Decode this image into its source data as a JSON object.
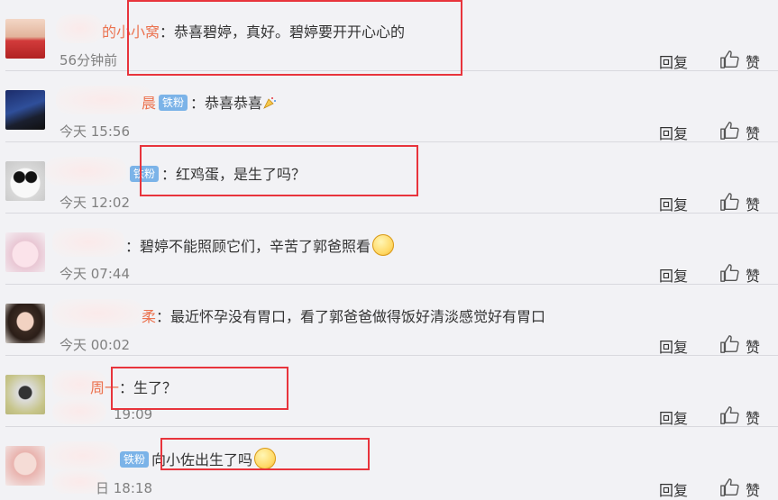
{
  "comments": [
    {
      "name_frag": "的小小窝",
      "badge": "",
      "text": "：恭喜碧婷，真好。碧婷要开开心心的",
      "time": "56分钟前",
      "reply": "回复",
      "like": "赞",
      "emoji": ""
    },
    {
      "name_frag": "晨",
      "badge": "铁粉",
      "text": "：恭喜恭喜",
      "time": "今天 15:56",
      "reply": "回复",
      "like": "赞",
      "emoji": "party-popper"
    },
    {
      "name_frag": "",
      "badge": "铁粉",
      "text": "：红鸡蛋，是生了吗？",
      "time": "今天 12:02",
      "reply": "回复",
      "like": "赞",
      "emoji": ""
    },
    {
      "name_frag": "",
      "badge": "",
      "text": "：碧婷不能照顾它们，辛苦了郭爸照看",
      "time": "今天 07:44",
      "reply": "回复",
      "like": "赞",
      "emoji": "grin"
    },
    {
      "name_frag": "柔",
      "badge": "",
      "text": "：最近怀孕没有胃口，看了郭爸爸做得饭好清淡感觉好有胃口",
      "time": "今天 00:02",
      "reply": "回复",
      "like": "赞",
      "emoji": ""
    },
    {
      "name_frag": "周一",
      "badge": "",
      "text": "：生了？",
      "time": "19:09",
      "reply": "回复",
      "like": "赞",
      "emoji": ""
    },
    {
      "name_frag": "",
      "badge": "铁粉",
      "text": "向小佐出生了吗",
      "time": "日 18:18",
      "reply": "回复",
      "like": "赞",
      "emoji": "smile"
    }
  ],
  "icons": {
    "like": "thumbs-up-icon"
  },
  "colors": {
    "username": "#eb7350",
    "badge": "#7bb3e8",
    "highlight_box": "#e8343c"
  }
}
